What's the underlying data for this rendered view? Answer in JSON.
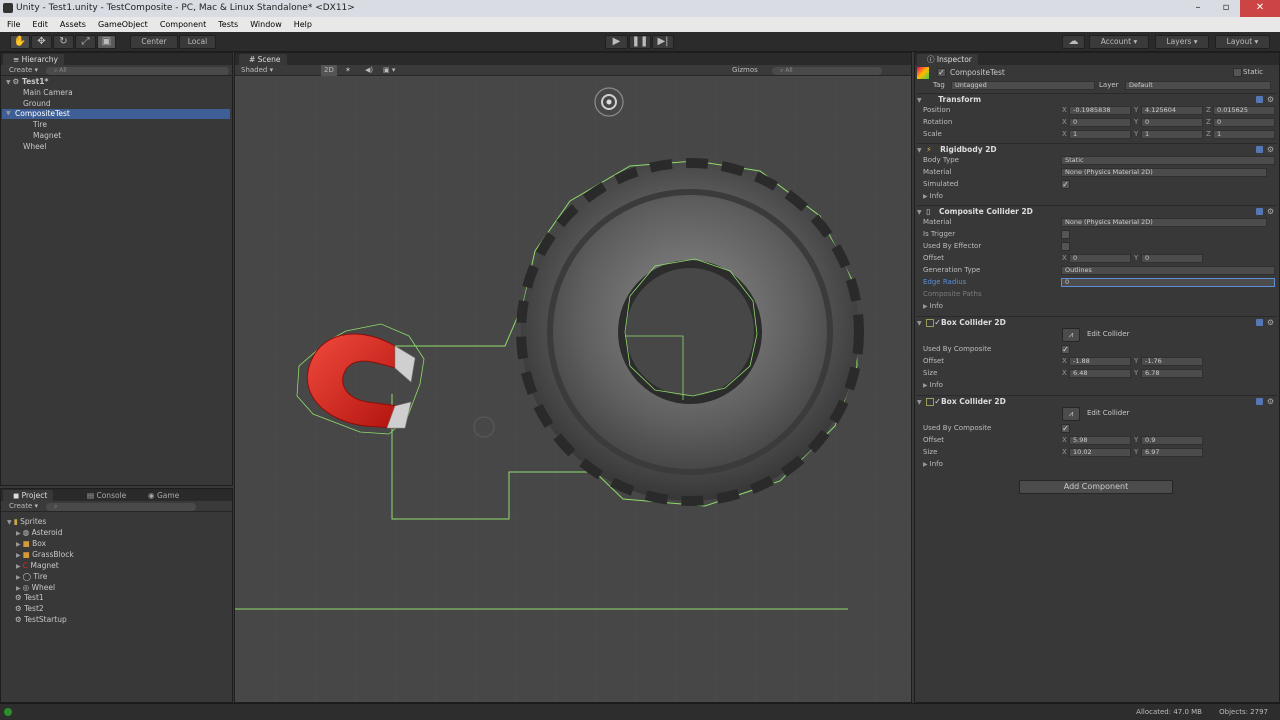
{
  "window": {
    "title": "Unity - Test1.unity - TestComposite - PC, Mac & Linux Standalone* <DX11>"
  },
  "menu": [
    "File",
    "Edit",
    "Assets",
    "GameObject",
    "Component",
    "Tests",
    "Window",
    "Help"
  ],
  "toolbar": {
    "pivot_center": "Center",
    "pivot_local": "Local",
    "account": "Account",
    "layers": "Layers",
    "layout": "Layout"
  },
  "hierarchy": {
    "tab": "Hierarchy",
    "create": "Create",
    "search_placeholder": "All",
    "scene": "Test1*",
    "items": [
      "Main Camera",
      "Ground",
      "CompositeTest",
      "Tire",
      "Magnet",
      "Wheel"
    ]
  },
  "scene": {
    "tab": "Scene",
    "shading": "Shaded",
    "mode_2d": "2D",
    "gizmos": "Gizmos",
    "search_placeholder": "All"
  },
  "project": {
    "tabs": [
      "Project",
      "Console",
      "Game"
    ],
    "create": "Create",
    "items": [
      "Sprites",
      "Asteroid",
      "Box",
      "GrassBlock",
      "Magnet",
      "Tire",
      "Wheel",
      "Test1",
      "Test2",
      "TestStartup"
    ]
  },
  "inspector": {
    "tab": "Inspector",
    "object_name": "CompositeTest",
    "static": "Static",
    "tag_label": "Tag",
    "tag_value": "Untagged",
    "layer_label": "Layer",
    "layer_value": "Default",
    "transform": {
      "title": "Transform",
      "position_label": "Position",
      "rotation_label": "Rotation",
      "scale_label": "Scale",
      "position": [
        "-0.1985838",
        "4.125604",
        "0.015625"
      ],
      "rotation": [
        "0",
        "0",
        "0"
      ],
      "scale": [
        "1",
        "1",
        "1"
      ]
    },
    "rigidbody": {
      "title": "Rigidbody 2D",
      "body_type_label": "Body Type",
      "body_type": "Static",
      "material_label": "Material",
      "material": "None (Physics Material 2D)",
      "simulated_label": "Simulated",
      "info_label": "Info"
    },
    "composite": {
      "title": "Composite Collider 2D",
      "material_label": "Material",
      "material": "None (Physics Material 2D)",
      "is_trigger_label": "Is Trigger",
      "used_by_effector_label": "Used By Effector",
      "offset_label": "Offset",
      "offset": [
        "0",
        "0"
      ],
      "generation_type_label": "Generation Type",
      "generation_type": "Outlines",
      "edge_radius_label": "Edge Radius",
      "edge_radius": "0",
      "composite_paths_label": "Composite Paths",
      "info_label": "Info"
    },
    "box1": {
      "title": "Box Collider 2D",
      "edit_collider": "Edit Collider",
      "used_by_composite_label": "Used By Composite",
      "offset_label": "Offset",
      "offset": [
        "-1.88",
        "-1.76"
      ],
      "size_label": "Size",
      "size": [
        "6.48",
        "6.78"
      ],
      "info_label": "Info"
    },
    "box2": {
      "title": "Box Collider 2D",
      "edit_collider": "Edit Collider",
      "used_by_composite_label": "Used By Composite",
      "offset_label": "Offset",
      "offset": [
        "5.98",
        "0.9"
      ],
      "size_label": "Size",
      "size": [
        "10.02",
        "6.97"
      ],
      "info_label": "Info"
    },
    "add_component": "Add Component"
  },
  "status": {
    "allocated": "Allocated: 47.0 MB",
    "objects": "Objects: 2797"
  },
  "colors": {
    "selection": "#3e5f96",
    "collider_outline": "#8fdc6a",
    "magnet_red": "#d8261e",
    "tire_gray": "#4a4a4a"
  }
}
